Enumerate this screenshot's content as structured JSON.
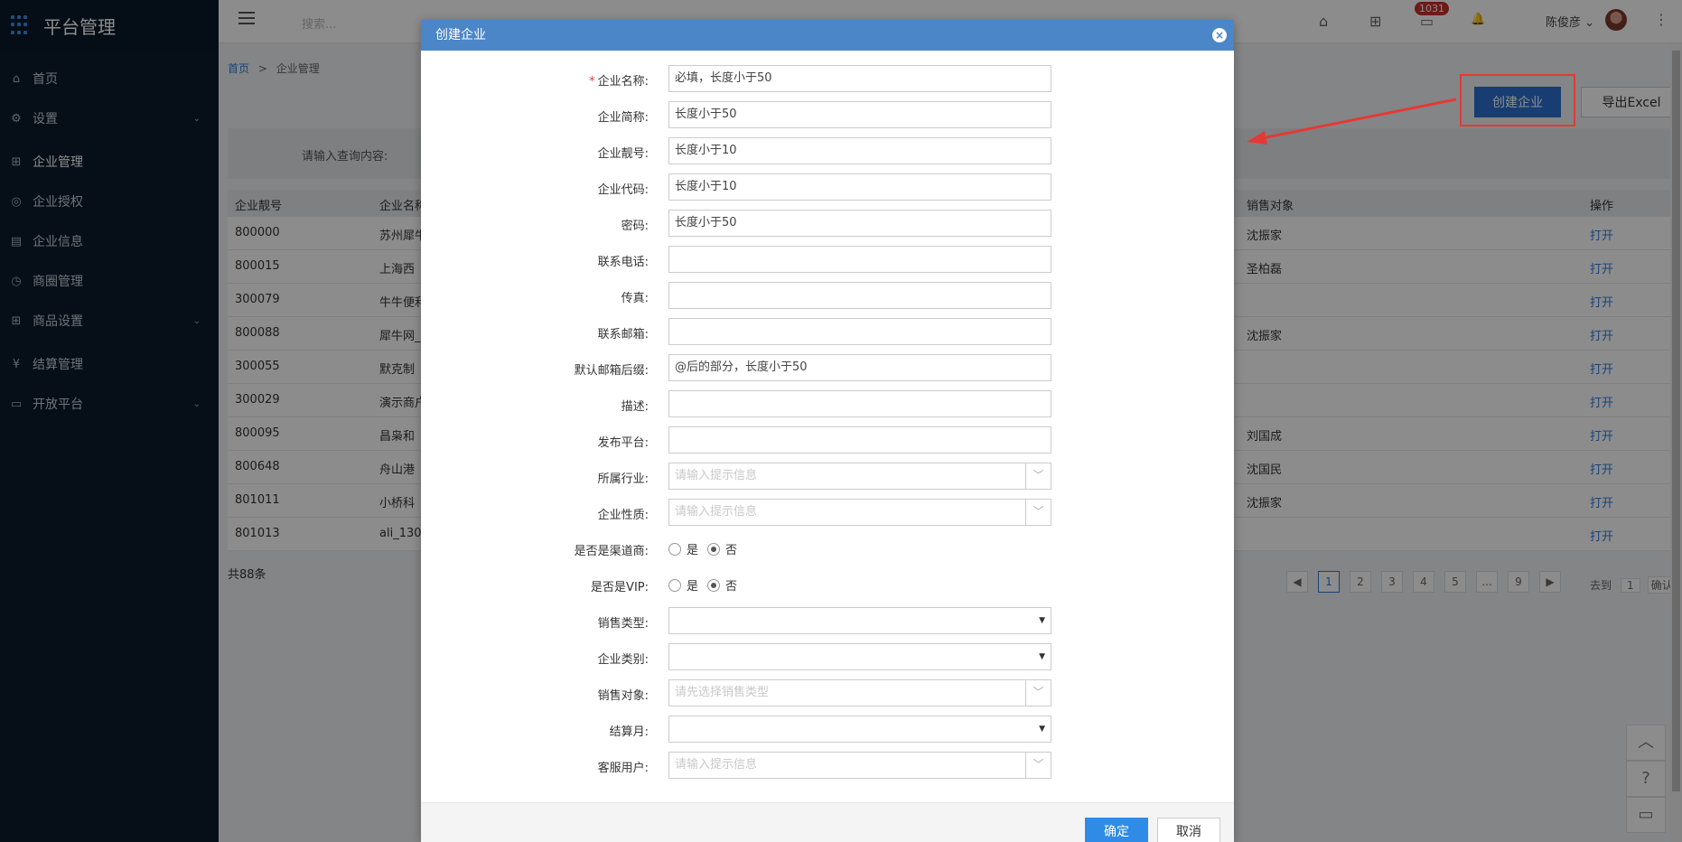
{
  "sidebar": {
    "brand": "平台管理",
    "items": [
      {
        "label": "首页",
        "icon": "⌂"
      },
      {
        "label": "设置",
        "icon": "⚙",
        "chev": "⌄"
      },
      {
        "label": "企业管理",
        "icon": "⊞"
      },
      {
        "label": "企业授权",
        "icon": "◎"
      },
      {
        "label": "企业信息",
        "icon": "▤"
      },
      {
        "label": "商圈管理",
        "icon": "◷"
      },
      {
        "label": "商品设置",
        "icon": "⊞",
        "chev": "⌄"
      },
      {
        "label": "结算管理",
        "icon": "¥"
      },
      {
        "label": "开放平台",
        "icon": "▭",
        "chev": "⌄"
      }
    ]
  },
  "topbar": {
    "search_placeholder": "搜索...",
    "badge": "1031",
    "user": "陈俊彦 ⌄",
    "icons": {
      "home": "⌂",
      "apps": "⊞",
      "msg": "▭",
      "bell": "🔔",
      "more": "⋮"
    }
  },
  "breadcrumb": {
    "home": "首页",
    "sep": ">",
    "current": "企业管理"
  },
  "actions": {
    "create": "创建企业",
    "export": "导出Excel"
  },
  "filter": {
    "label": "请输入查询内容:"
  },
  "table": {
    "headers": [
      "企业靓号",
      "企业名称",
      "销售对象",
      "操作"
    ],
    "rows": [
      {
        "id": "800000",
        "name": "苏州犀牛",
        "sales": "沈振家",
        "op": "打开"
      },
      {
        "id": "800015",
        "name": "上海西",
        "sales": "圣柏磊",
        "op": "打开"
      },
      {
        "id": "300079",
        "name": "牛牛便利",
        "sales": "",
        "op": "打开"
      },
      {
        "id": "800088",
        "name": "犀牛网_",
        "sales": "沈振家",
        "op": "打开"
      },
      {
        "id": "300055",
        "name": "默克制",
        "sales": "",
        "op": "打开"
      },
      {
        "id": "300029",
        "name": "演示商户",
        "sales": "",
        "op": "打开"
      },
      {
        "id": "800095",
        "name": "昌枭和",
        "sales": "刘国成",
        "op": "打开"
      },
      {
        "id": "800648",
        "name": "舟山港",
        "sales": "沈国民",
        "op": "打开"
      },
      {
        "id": "801011",
        "name": "小桥科",
        "sales": "沈振家",
        "op": "打开"
      },
      {
        "id": "801013",
        "name": "ali_130",
        "sales": "",
        "op": "打开"
      }
    ],
    "total": "共88条"
  },
  "pager": {
    "prev": "◀",
    "pages": [
      "1",
      "2",
      "3",
      "4",
      "5",
      "...",
      "9"
    ],
    "next": "▶",
    "goto_label": "去到",
    "goto_value": "1",
    "confirm": "确认"
  },
  "side_tools": {
    "top": "︿",
    "help": "?",
    "chat": "▭"
  },
  "modal": {
    "title": "创建企业",
    "close": "×",
    "fields": [
      {
        "label": "企业名称:",
        "required": true,
        "value": "必填，长度小于50",
        "kind": "text"
      },
      {
        "label": "企业简称:",
        "value": "长度小于50",
        "kind": "text"
      },
      {
        "label": "企业靓号:",
        "value": "长度小于10",
        "kind": "text"
      },
      {
        "label": "企业代码:",
        "value": "长度小于10",
        "kind": "text"
      },
      {
        "label": "密码:",
        "value": "长度小于50",
        "kind": "text"
      },
      {
        "label": "联系电话:",
        "value": "",
        "kind": "text"
      },
      {
        "label": "传真:",
        "value": "",
        "kind": "text"
      },
      {
        "label": "联系邮箱:",
        "value": "",
        "kind": "text"
      },
      {
        "label": "默认邮箱后缀:",
        "value": "@后的部分，长度小于50",
        "kind": "text"
      },
      {
        "label": "描述:",
        "value": "",
        "kind": "text"
      },
      {
        "label": "发布平台:",
        "value": "",
        "kind": "text"
      },
      {
        "label": "所属行业:",
        "placeholder": "请输入提示信息",
        "kind": "combo"
      },
      {
        "label": "企业性质:",
        "placeholder": "请输入提示信息",
        "kind": "combo"
      },
      {
        "label": "是否是渠道商:",
        "yes": "是",
        "no": "否",
        "selected": "no",
        "kind": "radio"
      },
      {
        "label": "是否是VIP:",
        "yes": "是",
        "no": "否",
        "selected": "no",
        "kind": "radio"
      },
      {
        "label": "销售类型:",
        "value": "",
        "kind": "select"
      },
      {
        "label": "企业类别:",
        "value": "",
        "kind": "select"
      },
      {
        "label": "销售对象:",
        "placeholder": "请先选择销售类型",
        "kind": "combo"
      },
      {
        "label": "结算月:",
        "value": "",
        "kind": "select"
      },
      {
        "label": "客服用户:",
        "placeholder": "请输入提示信息",
        "kind": "combo"
      }
    ],
    "ok": "确定",
    "cancel": "取消",
    "select_arrow": "▼",
    "combo_arrow": "﹀"
  },
  "colors": {
    "sidebar_bg": "#0b1a2b",
    "primary": "#2a6fd0",
    "modal_header": "#4a86c8",
    "highlight": "#e53935"
  }
}
